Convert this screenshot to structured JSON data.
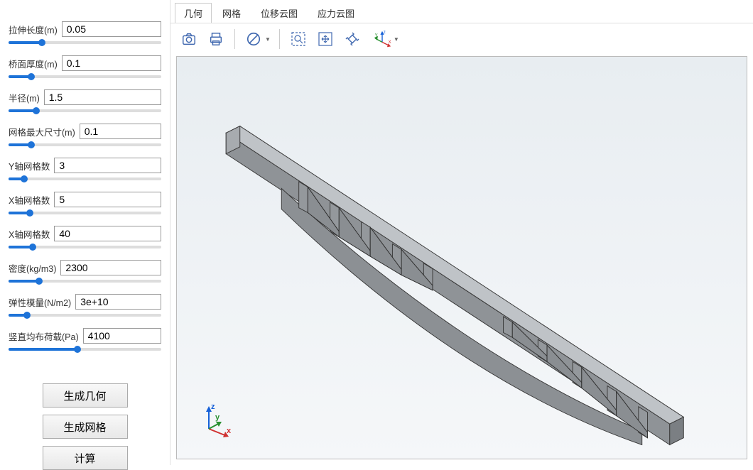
{
  "params": [
    {
      "label": "拉伸长度(m)",
      "value": "0.05",
      "slider": 22
    },
    {
      "label": "桥面厚度(m)",
      "value": "0.1",
      "slider": 15
    },
    {
      "label": "半径(m)",
      "value": "1.5",
      "slider": 18
    },
    {
      "label": "网格最大尺寸(m)",
      "value": "0.1",
      "slider": 15
    },
    {
      "label": "Y轴网格数",
      "value": "3",
      "slider": 10
    },
    {
      "label": "X轴网格数",
      "value": "5",
      "slider": 14
    },
    {
      "label": "X轴网格数",
      "value": "40",
      "slider": 16
    },
    {
      "label": "密度(kg/m3)",
      "value": "2300",
      "slider": 20
    },
    {
      "label": "弹性模量(N/m2)",
      "value": "3e+10",
      "slider": 12
    },
    {
      "label": "竖直均布荷载(Pa)",
      "value": "4100",
      "slider": 45
    }
  ],
  "buttons": {
    "gen_geom": "生成几何",
    "gen_mesh": "生成网格",
    "compute": "计算"
  },
  "tabs": [
    {
      "label": "几何",
      "active": true
    },
    {
      "label": "网格",
      "active": false
    },
    {
      "label": "位移云图",
      "active": false
    },
    {
      "label": "应力云图",
      "active": false
    }
  ],
  "toolbar_icons": {
    "camera": "camera-icon",
    "print": "print-icon",
    "forbid": "no-entry-icon",
    "zoom_box": "zoom-box-icon",
    "pan": "pan-icon",
    "rotate": "rotate-icon",
    "triad": "axes-icon"
  },
  "triad": {
    "x": "x",
    "y": "y",
    "z": "z"
  }
}
